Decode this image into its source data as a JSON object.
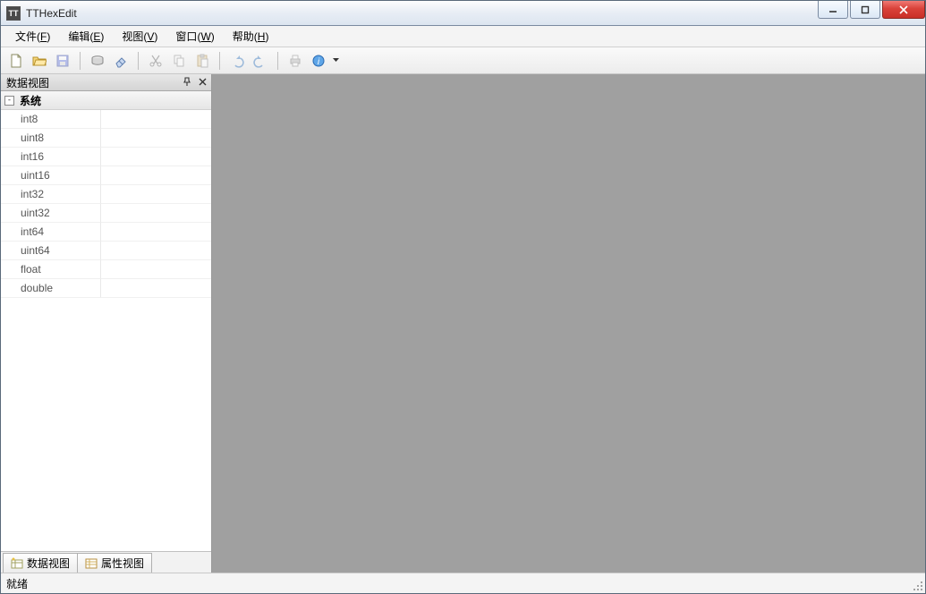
{
  "title": "TTHexEdit",
  "menubar": [
    {
      "label": "文件",
      "hotkey": "F"
    },
    {
      "label": "编辑",
      "hotkey": "E"
    },
    {
      "label": "视图",
      "hotkey": "V"
    },
    {
      "label": "窗口",
      "hotkey": "W"
    },
    {
      "label": "帮助",
      "hotkey": "H"
    }
  ],
  "toolbar": {
    "new": "new",
    "open": "open",
    "save": "save",
    "disk": "disk",
    "memory": "memory",
    "cut": "cut",
    "copy": "copy",
    "paste": "paste",
    "undo": "undo",
    "redo": "redo",
    "print": "print",
    "help": "help"
  },
  "dataView": {
    "title": "数据视图",
    "group": "系统",
    "rows": [
      {
        "name": "int8",
        "value": ""
      },
      {
        "name": "uint8",
        "value": ""
      },
      {
        "name": "int16",
        "value": ""
      },
      {
        "name": "uint16",
        "value": ""
      },
      {
        "name": "int32",
        "value": ""
      },
      {
        "name": "uint32",
        "value": ""
      },
      {
        "name": "int64",
        "value": ""
      },
      {
        "name": "uint64",
        "value": ""
      },
      {
        "name": "float",
        "value": ""
      },
      {
        "name": "double",
        "value": ""
      }
    ]
  },
  "paneTabs": {
    "data": "数据视图",
    "props": "属性视图"
  },
  "status": "就绪",
  "expander": "-"
}
